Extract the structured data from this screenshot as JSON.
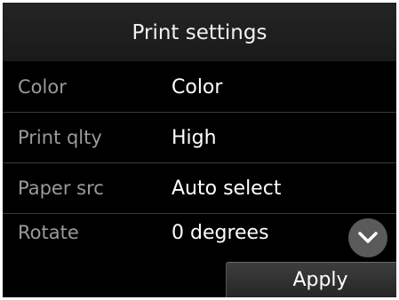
{
  "screen": {
    "title": "Print settings"
  },
  "settings": [
    {
      "label": "Color",
      "value": "Color"
    },
    {
      "label": "Print qlty",
      "value": "High"
    },
    {
      "label": "Paper src",
      "value": "Auto select"
    },
    {
      "label": "Rotate",
      "value": "0 degrees"
    }
  ],
  "controls": {
    "scroll_down_icon": "chevron-down-icon",
    "apply_label": "Apply"
  },
  "colors": {
    "background": "#000000",
    "label_text": "#9a9a9a",
    "value_text": "#ffffff",
    "scroll_button": "#5a5a5a"
  }
}
